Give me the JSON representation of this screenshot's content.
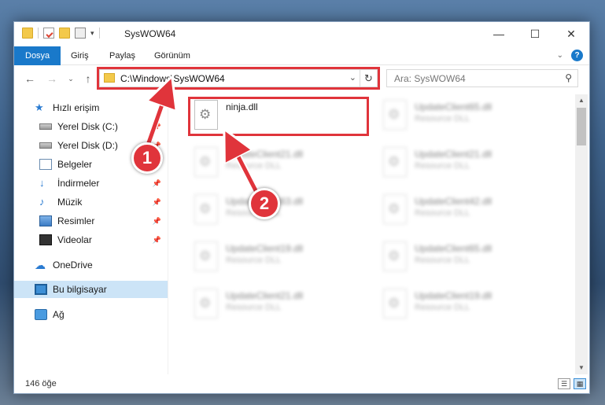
{
  "window": {
    "title": "SysWOW64",
    "controls": {
      "minimize": "—",
      "maximize": "☐",
      "close": "✕"
    }
  },
  "ribbon": {
    "tabs": [
      "Dosya",
      "Giriş",
      "Paylaş",
      "Görünüm"
    ],
    "active_tab": "Dosya",
    "help": "?"
  },
  "address": {
    "path": "C:\\Windows\\SysWOW64",
    "search_placeholder": "Ara: SysWOW64"
  },
  "sidebar": {
    "items": [
      {
        "label": "Hızlı erişim",
        "icon": "star-icon",
        "pinned": false
      },
      {
        "label": "Yerel Disk (C:)",
        "icon": "drive-icon",
        "pinned": true
      },
      {
        "label": "Yerel Disk (D:)",
        "icon": "drive-icon",
        "pinned": true
      },
      {
        "label": "Belgeler",
        "icon": "documents-icon",
        "pinned": true
      },
      {
        "label": "İndirmeler",
        "icon": "download-icon",
        "pinned": true
      },
      {
        "label": "Müzik",
        "icon": "music-icon",
        "pinned": true
      },
      {
        "label": "Resimler",
        "icon": "pictures-icon",
        "pinned": true
      },
      {
        "label": "Videolar",
        "icon": "videos-icon",
        "pinned": true
      },
      {
        "label": "OneDrive",
        "icon": "onedrive-icon",
        "pinned": false
      },
      {
        "label": "Bu bilgisayar",
        "icon": "this-pc-icon",
        "pinned": false,
        "selected": true
      },
      {
        "label": "Ağ",
        "icon": "network-icon",
        "pinned": false
      }
    ]
  },
  "files": [
    {
      "name": "ninja.dll",
      "desc": "",
      "highlighted": true
    },
    {
      "name": "UpdateClient65.dll",
      "desc": "Resource DLL"
    },
    {
      "name": "UpdateClient21.dll",
      "desc": "Resource DLL"
    },
    {
      "name": "UpdateClient21.dll",
      "desc": "Resource DLL"
    },
    {
      "name": "UpdateClient63.dll",
      "desc": "Resource DLL"
    },
    {
      "name": "UpdateClient42.dll",
      "desc": "Resource DLL"
    },
    {
      "name": "UpdateClient19.dll",
      "desc": "Resource DLL"
    },
    {
      "name": "UpdateClient65.dll",
      "desc": "Resource DLL"
    },
    {
      "name": "UpdateClient21.dll",
      "desc": "Resource DLL"
    },
    {
      "name": "UpdateClient19.dll",
      "desc": "Resource DLL"
    }
  ],
  "status": {
    "item_count": "146 öğe"
  },
  "callouts": {
    "step1": "1",
    "step2": "2"
  },
  "colors": {
    "accent": "#1979ca",
    "highlight": "#e0343b",
    "selected_bg": "#cce4f7"
  }
}
